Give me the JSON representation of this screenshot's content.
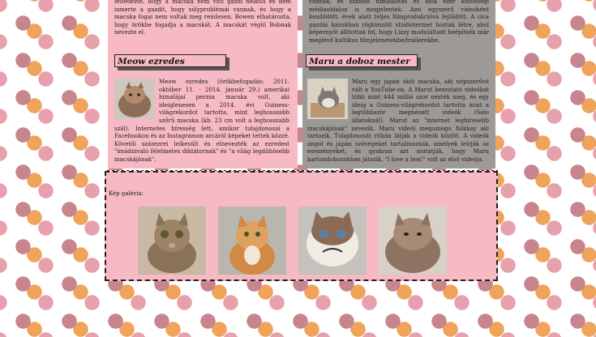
{
  "left_column": {
    "intro_text": "felfedezte, hogy a macska nem volt gazdi nélküli és nem ismerte a gazdit, hogy súlyproblémái vannak, és hogy a macska fogai nem voltak meg rendesen. Bowen elhatározta, hogy örökbe fogadja a macskát. A macskát végül Bobnak nevezte el.",
    "intro_visible_start": "felfedezte, hogy a macska nem volt gazdi nélküli és nem ismerte a gazdit...",
    "heading": "Meow ezredes",
    "article": "Meow ezredes (örökbefogadás: 2011. október 11. - 2014. január 29.) amerikai himalájai perzsa macska volt, aki ideiglenesen a 2014. évi Guiness-világrekordot tartotta, mint leghosszabb szőrű macska (kb. 23 cm volt a leghosszabb szál). Internetes híresség lett, amikor tulajdonosai a Facebookon és az Instagramon arcáról képeket tettek közzé. Követői százezrei lelkesült és elnevezték az ezredest \"imádnivaló félelmetes diktátornak\" és \"a világ legdühösebb macskájának\"."
  },
  "right_column": {
    "intro_text": "vannak, és számos filmalkotás és idők ezer közösségi médiaoldalon is megjelentek. Ami egyszerű videóként kezdődött, évek alatt teljes filmprodukcióvá fejlődött. A cica gazdái házukban rögtönzött stúdiótermet hoztak létre, ahol képernyőt állítottak fel, hogy Lizzy moduláltadt beépítsék már meglévő kultikus filmjelenetekbe/trailerekbe.",
    "heading": "Maru a doboz mester",
    "article": "Maru egy japán skót macska, aki népszerűvé vált a YouTube-on. A Marut bemutató videókat több mint 444 millió szor nézték meg, és egy ideig a Guiness-világrekordot tartotta mint a legtöbbször megnézett videók (Solo állatoknál). Marut az \"internet leghíresebb macskájának\" nevezik. Maru videói megumogu fiókkay aki tartozik. Tulajdonosát ritkán látják a videók között. A videók angol és japán szövegeket tartalmaznak, amelyek leírják az eseményeket, és gyakran azt mutatják, hogy Maru kartondobozokban játszik, \"I love a box!\" volt az első videója."
  },
  "gallery": {
    "title": "Kép galéria:",
    "images": [
      {
        "alt": "Lil Bub"
      },
      {
        "alt": "Bob"
      },
      {
        "alt": "Grumpy Cat"
      },
      {
        "alt": "Meow ezredes"
      }
    ]
  },
  "colors": {
    "pink": "#f7b9c4",
    "grey": "#9c9996",
    "paw_brown": "#c7858e",
    "paw_orange": "#f0a35a"
  }
}
